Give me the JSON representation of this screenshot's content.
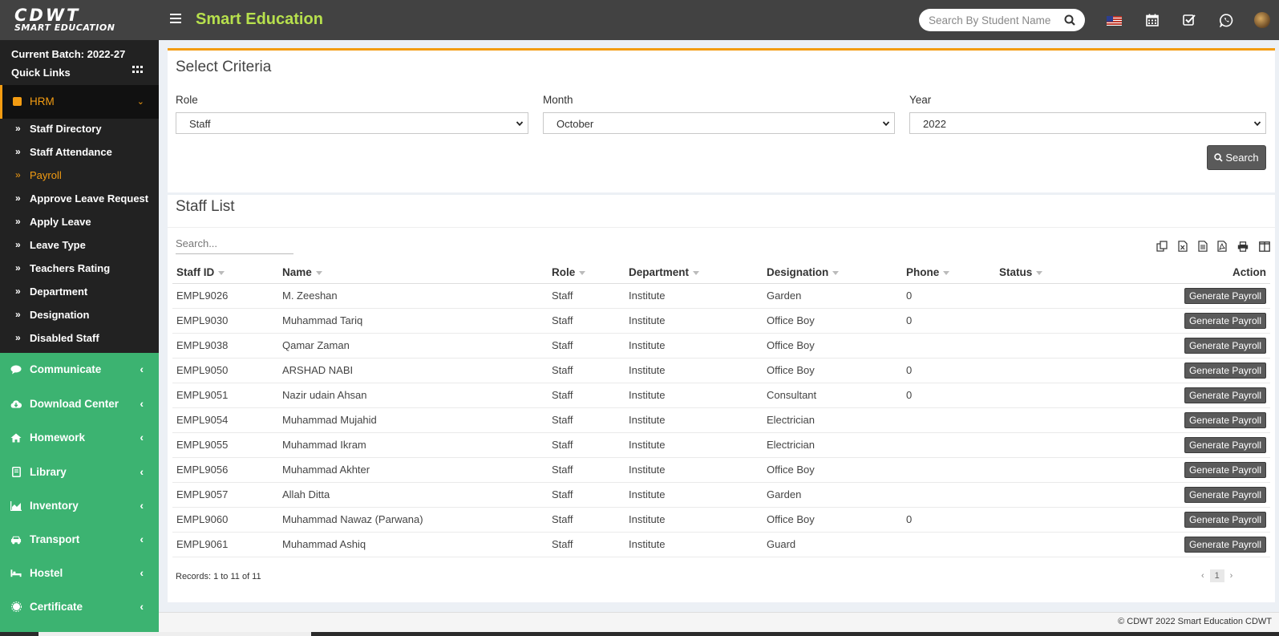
{
  "brand": {
    "logo_line1": "CDWT",
    "logo_line2": "SMART EDUCATION",
    "app_title": "Smart Education"
  },
  "header": {
    "search_placeholder": "Search By Student Name",
    "icons": [
      "search-icon",
      "flag-us-icon",
      "calendar-icon",
      "checkbox-icon",
      "whatsapp-icon",
      "avatar"
    ]
  },
  "sidebar": {
    "batch": "Current Batch: 2022-27",
    "quick_links": "Quick Links",
    "active_section": "HRM",
    "hrm_items": [
      "Staff Directory",
      "Staff Attendance",
      "Payroll",
      "Approve Leave Request",
      "Apply Leave",
      "Leave Type",
      "Teachers Rating",
      "Department",
      "Designation",
      "Disabled Staff"
    ],
    "active_item": "Payroll",
    "sections": [
      "Communicate",
      "Download Center",
      "Homework",
      "Library",
      "Inventory",
      "Transport",
      "Hostel",
      "Certificate"
    ],
    "colors": {
      "accent": "#f39c12",
      "sections_bg": "#3cb371"
    }
  },
  "criteria": {
    "title": "Select Criteria",
    "role_label": "Role",
    "role_value": "Staff",
    "month_label": "Month",
    "month_value": "October",
    "year_label": "Year",
    "year_value": "2022",
    "search_button": "Search"
  },
  "staff_list": {
    "title": "Staff List",
    "search_placeholder": "Search...",
    "columns": [
      "Staff ID",
      "Name",
      "Role",
      "Department",
      "Designation",
      "Phone",
      "Status",
      "Action"
    ],
    "rows": [
      [
        "EMPL9026",
        "M. Zeeshan",
        "Staff",
        "Institute",
        "Garden",
        "0",
        ""
      ],
      [
        "EMPL9030",
        "Muhammad Tariq",
        "Staff",
        "Institute",
        "Office Boy",
        "0",
        ""
      ],
      [
        "EMPL9038",
        "Qamar Zaman",
        "Staff",
        "Institute",
        "Office Boy",
        "",
        ""
      ],
      [
        "EMPL9050",
        "ARSHAD NABI",
        "Staff",
        "Institute",
        "Office Boy",
        "0",
        ""
      ],
      [
        "EMPL9051",
        "Nazir udain Ahsan",
        "Staff",
        "Institute",
        "Consultant",
        "0",
        ""
      ],
      [
        "EMPL9054",
        "Muhammad Mujahid",
        "Staff",
        "Institute",
        "Electrician",
        "",
        ""
      ],
      [
        "EMPL9055",
        "Muhammad Ikram",
        "Staff",
        "Institute",
        "Electrician",
        "",
        ""
      ],
      [
        "EMPL9056",
        "Muhammad Akhter",
        "Staff",
        "Institute",
        "Office Boy",
        "",
        ""
      ],
      [
        "EMPL9057",
        "Allah Ditta",
        "Staff",
        "Institute",
        "Garden",
        "",
        ""
      ],
      [
        "EMPL9060",
        "Muhammad Nawaz (Parwana)",
        "Staff",
        "Institute",
        "Office Boy",
        "0",
        ""
      ],
      [
        "EMPL9061",
        "Muhammad Ashiq",
        "Staff",
        "Institute",
        "Guard",
        "",
        ""
      ]
    ],
    "action_label": "Generate Payroll",
    "records": "Records: 1 to 11 of 11",
    "page": "1",
    "prev": "‹",
    "next": "›"
  },
  "footer": {
    "copyright": "© CDWT 2022 Smart Education CDWT"
  }
}
